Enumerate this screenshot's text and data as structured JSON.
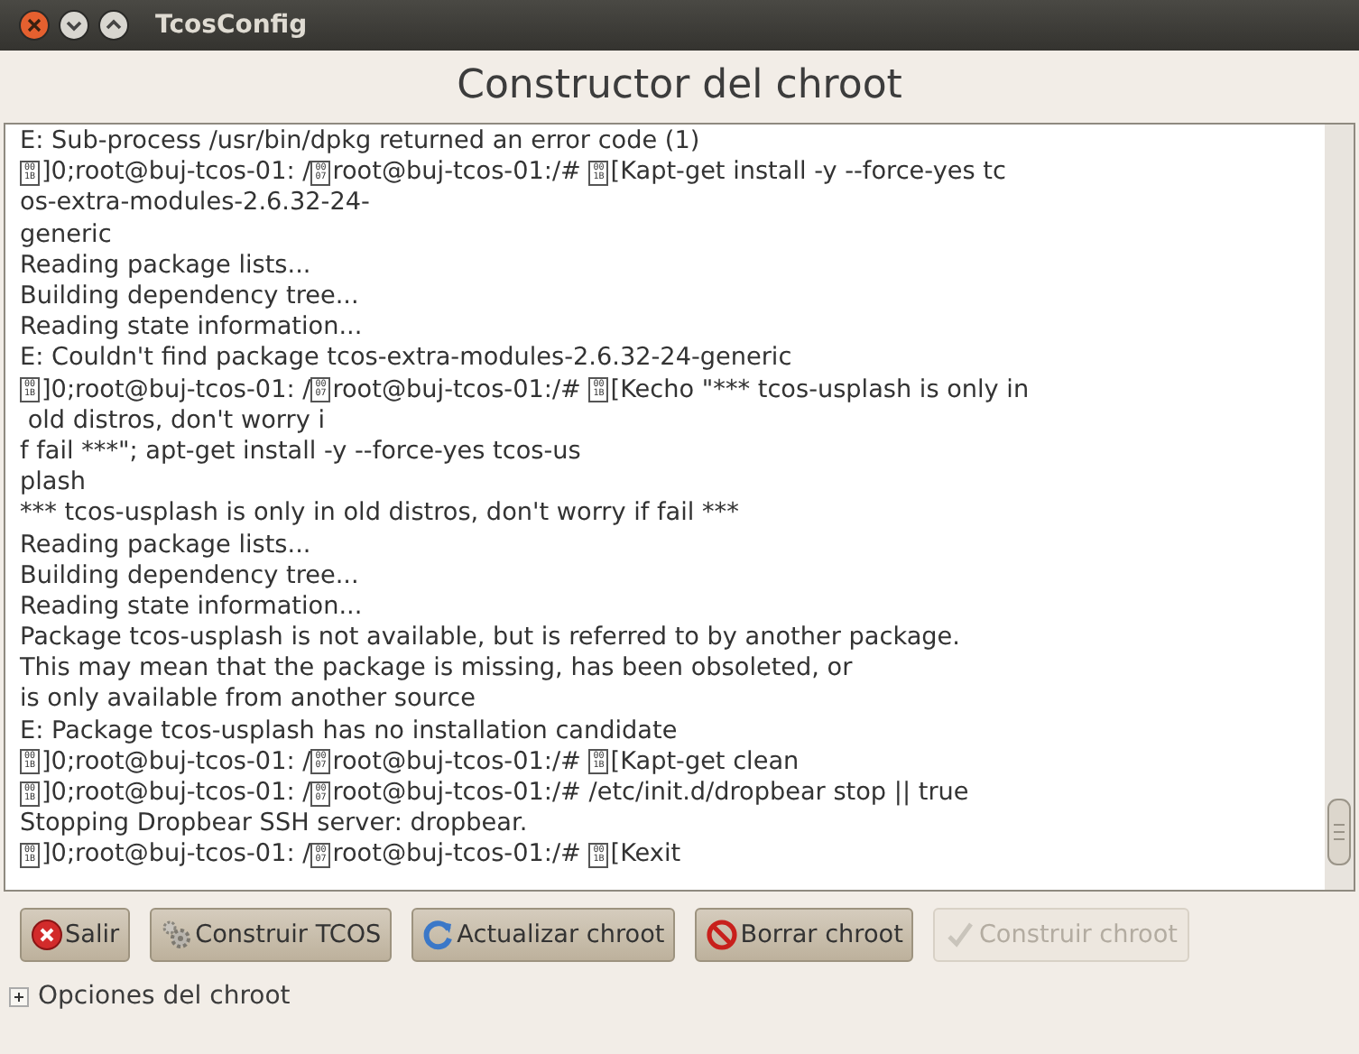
{
  "window": {
    "title": "TcosConfig"
  },
  "heading": "Constructor del chroot",
  "log_lines": [
    [
      {
        "kind": "text",
        "text": "E: Sub-process /usr/bin/dpkg returned an error code (1)"
      }
    ],
    [
      {
        "kind": "glyph",
        "rows": [
          "00",
          "1B"
        ]
      },
      {
        "kind": "text",
        "text": "]0;root@buj-tcos-01: /"
      },
      {
        "kind": "glyph",
        "rows": [
          "00",
          "07"
        ]
      },
      {
        "kind": "text",
        "text": "root@buj-tcos-01:/# "
      },
      {
        "kind": "glyph",
        "rows": [
          "00",
          "1B"
        ]
      },
      {
        "kind": "text",
        "text": "[Kapt-get install -y --force-yes tc"
      }
    ],
    [
      {
        "kind": "text",
        "text": "os-extra-modules-2.6.32-24-"
      }
    ],
    [
      {
        "kind": "text",
        "text": "generic"
      }
    ],
    [
      {
        "kind": "text",
        "text": "Reading package lists..."
      }
    ],
    [
      {
        "kind": "text",
        "text": "Building dependency tree..."
      }
    ],
    [
      {
        "kind": "text",
        "text": "Reading state information..."
      }
    ],
    [
      {
        "kind": "text",
        "text": "E: Couldn't find package tcos-extra-modules-2.6.32-24-generic"
      }
    ],
    [
      {
        "kind": "glyph",
        "rows": [
          "00",
          "1B"
        ]
      },
      {
        "kind": "text",
        "text": "]0;root@buj-tcos-01: /"
      },
      {
        "kind": "glyph",
        "rows": [
          "00",
          "07"
        ]
      },
      {
        "kind": "text",
        "text": "root@buj-tcos-01:/# "
      },
      {
        "kind": "glyph",
        "rows": [
          "00",
          "1B"
        ]
      },
      {
        "kind": "text",
        "text": "[Kecho \"*** tcos-usplash is only in"
      }
    ],
    [
      {
        "kind": "text",
        "text": " old distros, don't worry i"
      }
    ],
    [
      {
        "kind": "text",
        "text": "f fail ***\"; apt-get install -y --force-yes tcos-us"
      }
    ],
    [
      {
        "kind": "text",
        "text": "plash"
      }
    ],
    [
      {
        "kind": "text",
        "text": "*** tcos-usplash is only in old distros, don't worry if fail ***"
      }
    ],
    [
      {
        "kind": "text",
        "text": "Reading package lists..."
      }
    ],
    [
      {
        "kind": "text",
        "text": "Building dependency tree..."
      }
    ],
    [
      {
        "kind": "text",
        "text": "Reading state information..."
      }
    ],
    [
      {
        "kind": "text",
        "text": "Package tcos-usplash is not available, but is referred to by another package."
      }
    ],
    [
      {
        "kind": "text",
        "text": "This may mean that the package is missing, has been obsoleted, or"
      }
    ],
    [
      {
        "kind": "text",
        "text": "is only available from another source"
      }
    ],
    [
      {
        "kind": "text",
        "text": "E: Package tcos-usplash has no installation candidate"
      }
    ],
    [
      {
        "kind": "glyph",
        "rows": [
          "00",
          "1B"
        ]
      },
      {
        "kind": "text",
        "text": "]0;root@buj-tcos-01: /"
      },
      {
        "kind": "glyph",
        "rows": [
          "00",
          "07"
        ]
      },
      {
        "kind": "text",
        "text": "root@buj-tcos-01:/# "
      },
      {
        "kind": "glyph",
        "rows": [
          "00",
          "1B"
        ]
      },
      {
        "kind": "text",
        "text": "[Kapt-get clean"
      }
    ],
    [
      {
        "kind": "glyph",
        "rows": [
          "00",
          "1B"
        ]
      },
      {
        "kind": "text",
        "text": "]0;root@buj-tcos-01: /"
      },
      {
        "kind": "glyph",
        "rows": [
          "00",
          "07"
        ]
      },
      {
        "kind": "text",
        "text": "root@buj-tcos-01:/# /etc/init.d/dropbear stop || true"
      }
    ],
    [
      {
        "kind": "text",
        "text": "Stopping Dropbear SSH server: dropbear."
      }
    ],
    [
      {
        "kind": "glyph",
        "rows": [
          "00",
          "1B"
        ]
      },
      {
        "kind": "text",
        "text": "]0;root@buj-tcos-01: /"
      },
      {
        "kind": "glyph",
        "rows": [
          "00",
          "07"
        ]
      },
      {
        "kind": "text",
        "text": "root@buj-tcos-01:/# "
      },
      {
        "kind": "glyph",
        "rows": [
          "00",
          "1B"
        ]
      },
      {
        "kind": "text",
        "text": "[Kexit"
      }
    ]
  ],
  "buttons": [
    {
      "label": "Salir",
      "kind": "quit",
      "disabled": false
    },
    {
      "label": "Construir TCOS",
      "kind": "build",
      "disabled": false
    },
    {
      "label": "Actualizar chroot",
      "kind": "refresh",
      "disabled": false
    },
    {
      "label": "Borrar chroot",
      "kind": "delete",
      "disabled": false
    },
    {
      "label": "Construir chroot",
      "kind": "check",
      "disabled": true
    }
  ],
  "expander": {
    "label": "Opciones del chroot",
    "expanded": false
  }
}
